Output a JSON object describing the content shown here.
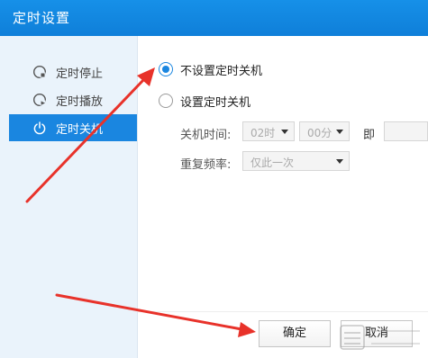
{
  "window": {
    "title": "定时设置"
  },
  "sidebar": {
    "items": [
      {
        "label": "定时停止",
        "icon": "stop-timer-icon",
        "active": false
      },
      {
        "label": "定时播放",
        "icon": "play-timer-icon",
        "active": false
      },
      {
        "label": "定时关机",
        "icon": "power-icon",
        "active": true
      }
    ]
  },
  "options": {
    "no_shutdown_label": "不设置定时关机",
    "set_shutdown_label": "设置定时关机",
    "selected": "no_shutdown"
  },
  "shutdown_time": {
    "label": "关机时间:",
    "hour": "02时",
    "minute": "00分",
    "suffix": "即"
  },
  "repeat": {
    "label": "重复频率:",
    "value": "仅此一次"
  },
  "buttons": {
    "ok": "确定",
    "cancel": "取消"
  },
  "colors": {
    "titlebar": "#1690e8",
    "accent": "#1a86e0",
    "sidebar_bg": "#eaf3fb",
    "annotation_arrow": "#e8322a"
  }
}
